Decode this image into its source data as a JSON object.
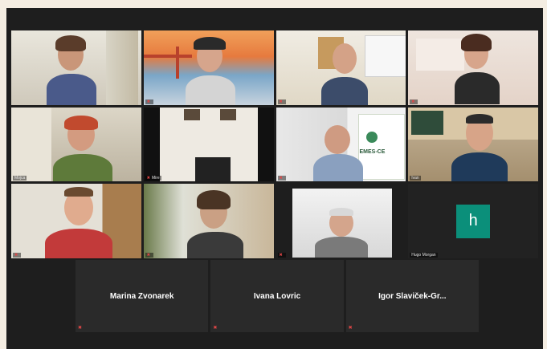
{
  "tiles": [
    {
      "name": "",
      "muted": false
    },
    {
      "name": "",
      "muted": true
    },
    {
      "name": "",
      "muted": true
    },
    {
      "name": "",
      "muted": true
    },
    {
      "name": "Mojca",
      "muted": false
    },
    {
      "name": "Mire",
      "muted": true
    },
    {
      "name": "",
      "muted": true
    },
    {
      "name": "Ivan",
      "muted": false
    },
    {
      "name": "",
      "muted": true
    },
    {
      "name": "",
      "muted": true
    },
    {
      "name": "",
      "muted": true
    },
    {
      "name": "Hugo Morgan",
      "muted": false
    }
  ],
  "avatar_letter": "h",
  "banner_text": "EMES-CE",
  "bottom_tiles": [
    {
      "name": "Marina Zvonarek"
    },
    {
      "name": "Ivana Lovric"
    },
    {
      "name": "Igor  Slaviček-Gr..."
    }
  ],
  "colors": {
    "background": "#f4ede2",
    "active_border": "#b7d46a",
    "mute_red": "#e04646",
    "avatar_bg": "#0b8f7a"
  },
  "icons": [
    "muted-mic-icon"
  ]
}
